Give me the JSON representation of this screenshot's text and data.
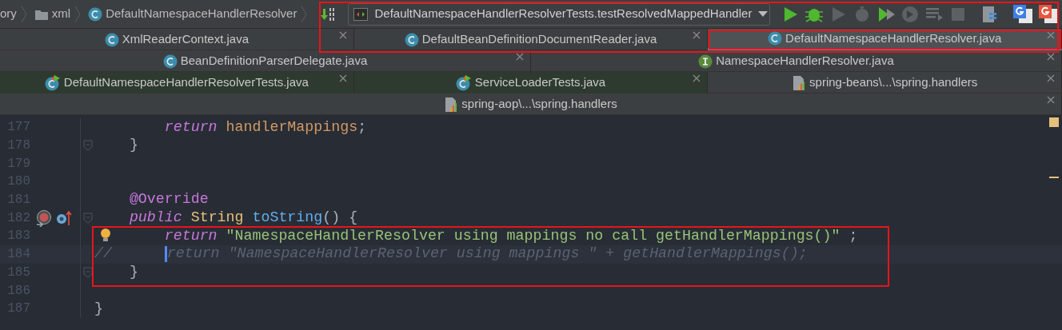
{
  "breadcrumbs": [
    {
      "label": "ory",
      "kind": "text"
    },
    {
      "label": "xml",
      "kind": "folder"
    },
    {
      "label": "DefaultNamespaceHandlerResolver",
      "kind": "class"
    }
  ],
  "toolbar": {
    "highlighted": true,
    "run_configuration": "DefaultNamespaceHandlerResolverTests.testResolvedMappedHandler",
    "buttons": [
      {
        "kind": "run",
        "disabled": false
      },
      {
        "kind": "debug",
        "disabled": false
      },
      {
        "kind": "run",
        "disabled": true
      },
      {
        "kind": "profile",
        "disabled": true
      },
      {
        "kind": "coverage",
        "disabled": false
      },
      {
        "kind": "attach",
        "disabled": true
      },
      {
        "kind": "step",
        "disabled": true
      },
      {
        "kind": "stop",
        "disabled": true
      },
      {
        "kind": "structure",
        "disabled": false
      },
      {
        "kind": "translate",
        "disabled": false,
        "color": "#3f7ee8"
      },
      {
        "kind": "translate",
        "disabled": false,
        "color": "#e8553f"
      }
    ]
  },
  "tab_rows": [
    [
      {
        "label": "XmlReaderContext.java",
        "kind": "class",
        "selected": false,
        "test": false,
        "highlighted": false
      },
      {
        "label": "DefaultBeanDefinitionDocumentReader.java",
        "kind": "class",
        "selected": false,
        "test": false,
        "highlighted": false
      },
      {
        "label": "DefaultNamespaceHandlerResolver.java",
        "kind": "class",
        "selected": true,
        "test": false,
        "highlighted": true
      }
    ],
    [
      {
        "label": "BeanDefinitionParserDelegate.java",
        "kind": "class",
        "selected": false,
        "test": false,
        "highlighted": false
      },
      {
        "label": "NamespaceHandlerResolver.java",
        "kind": "interface",
        "selected": false,
        "test": false,
        "highlighted": false
      }
    ],
    [
      {
        "label": "DefaultNamespaceHandlerResolverTests.java",
        "kind": "testclass",
        "selected": false,
        "test": true,
        "highlighted": false
      },
      {
        "label": "ServiceLoaderTests.java",
        "kind": "testclass",
        "selected": false,
        "test": true,
        "highlighted": false
      },
      {
        "label": "spring-beans\\...\\spring.handlers",
        "kind": "properties",
        "selected": false,
        "test": false,
        "highlighted": false
      }
    ],
    [
      {
        "label": "spring-aop\\...\\spring.handlers",
        "kind": "properties",
        "selected": false,
        "test": false,
        "highlighted": false
      }
    ]
  ],
  "editor": {
    "lines": [
      {
        "number": "177",
        "current": false,
        "highlighted": false,
        "fold": false,
        "tokens": [
          {
            "text": "        return",
            "kind": "keyword"
          },
          {
            "text": " handlerMappings",
            "kind": "field"
          },
          {
            "text": ";",
            "kind": "plain"
          }
        ]
      },
      {
        "number": "178",
        "current": false,
        "highlighted": false,
        "fold": true,
        "tokens": [
          {
            "text": "    }",
            "kind": "plain"
          }
        ]
      },
      {
        "number": "179",
        "current": false,
        "highlighted": false,
        "fold": false
      },
      {
        "number": "180",
        "current": false,
        "highlighted": false,
        "fold": false
      },
      {
        "number": "181",
        "current": false,
        "highlighted": false,
        "fold": false,
        "tokens": [
          {
            "text": "    @Override",
            "kind": "annotation"
          }
        ]
      },
      {
        "number": "182",
        "current": false,
        "highlighted": false,
        "fold": true,
        "markers": [
          {
            "kind": "overrides"
          },
          {
            "kind": "overridden"
          }
        ],
        "tokens": [
          {
            "text": "    public",
            "kind": "keyword"
          },
          {
            "text": " String",
            "kind": "type"
          },
          {
            "text": " toString",
            "kind": "method"
          },
          {
            "text": "() {",
            "kind": "plain"
          }
        ]
      },
      {
        "number": "183",
        "current": false,
        "highlighted": true,
        "fold": false,
        "bulb": true,
        "tokens": [
          {
            "text": "        return",
            "kind": "keyword"
          },
          {
            "text": " \"NamespaceHandlerResolver using mappings no call getHandlerMappings()\"",
            "kind": "string"
          },
          {
            "text": " ;",
            "kind": "plain"
          }
        ]
      },
      {
        "number": "184",
        "current": true,
        "highlighted": true,
        "fold": false,
        "tokens": [
          {
            "text": "//      ",
            "kind": "comment"
          },
          {
            "text": "return \"NamespaceHandlerResolver using mappings \" + getHandlerMappings();",
            "kind": "comment",
            "caret": true
          }
        ]
      },
      {
        "number": "185",
        "current": false,
        "highlighted": true,
        "fold": true,
        "tokens": [
          {
            "text": "    }",
            "kind": "plain"
          }
        ]
      },
      {
        "number": "186",
        "current": false,
        "highlighted": false,
        "fold": false
      },
      {
        "number": "187",
        "current": false,
        "highlighted": false,
        "fold": false,
        "tokens": [
          {
            "text": "}",
            "kind": "plain"
          }
        ]
      }
    ]
  }
}
